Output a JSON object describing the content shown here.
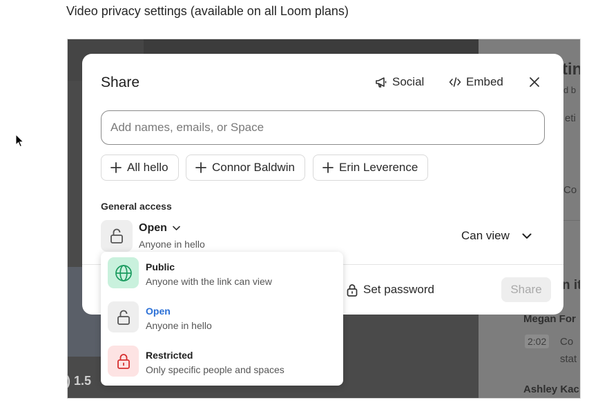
{
  "heading": "Video privacy settings (available on all Loom plans)",
  "background": {
    "speed_label": ") 1.5",
    "right_fragments": [
      "tin",
      "d b",
      "eti",
      "Co",
      "n ite",
      "Megan For",
      "2:02",
      "Co",
      "stat",
      "Ashley Kac"
    ]
  },
  "modal": {
    "title": "Share",
    "social_label": "Social",
    "embed_label": "Embed",
    "search_placeholder": "Add names, emails, or Space",
    "chips": [
      "All hello",
      "Connor Baldwin",
      "Erin Leverence"
    ],
    "general_access_label": "General access",
    "access_level": "Open",
    "access_sub": "Anyone in hello",
    "permission": "Can view",
    "set_password_label": "Set password",
    "share_button": "Share"
  },
  "access_menu": {
    "options": [
      {
        "title": "Public",
        "subtitle": "Anyone with the link can view",
        "icon": "globe-icon",
        "color": "#1a9b5f",
        "bg": "#c9f1dd",
        "selected": false
      },
      {
        "title": "Open",
        "subtitle": "Anyone in hello",
        "icon": "unlock-icon",
        "color": "#555555",
        "bg": "#eeeeee",
        "selected": true
      },
      {
        "title": "Restricted",
        "subtitle": "Only specific people and spaces",
        "icon": "lock-icon",
        "color": "#d62f2f",
        "bg": "#fde3e3",
        "selected": false
      }
    ],
    "selected_color": "#2a6fd6"
  }
}
